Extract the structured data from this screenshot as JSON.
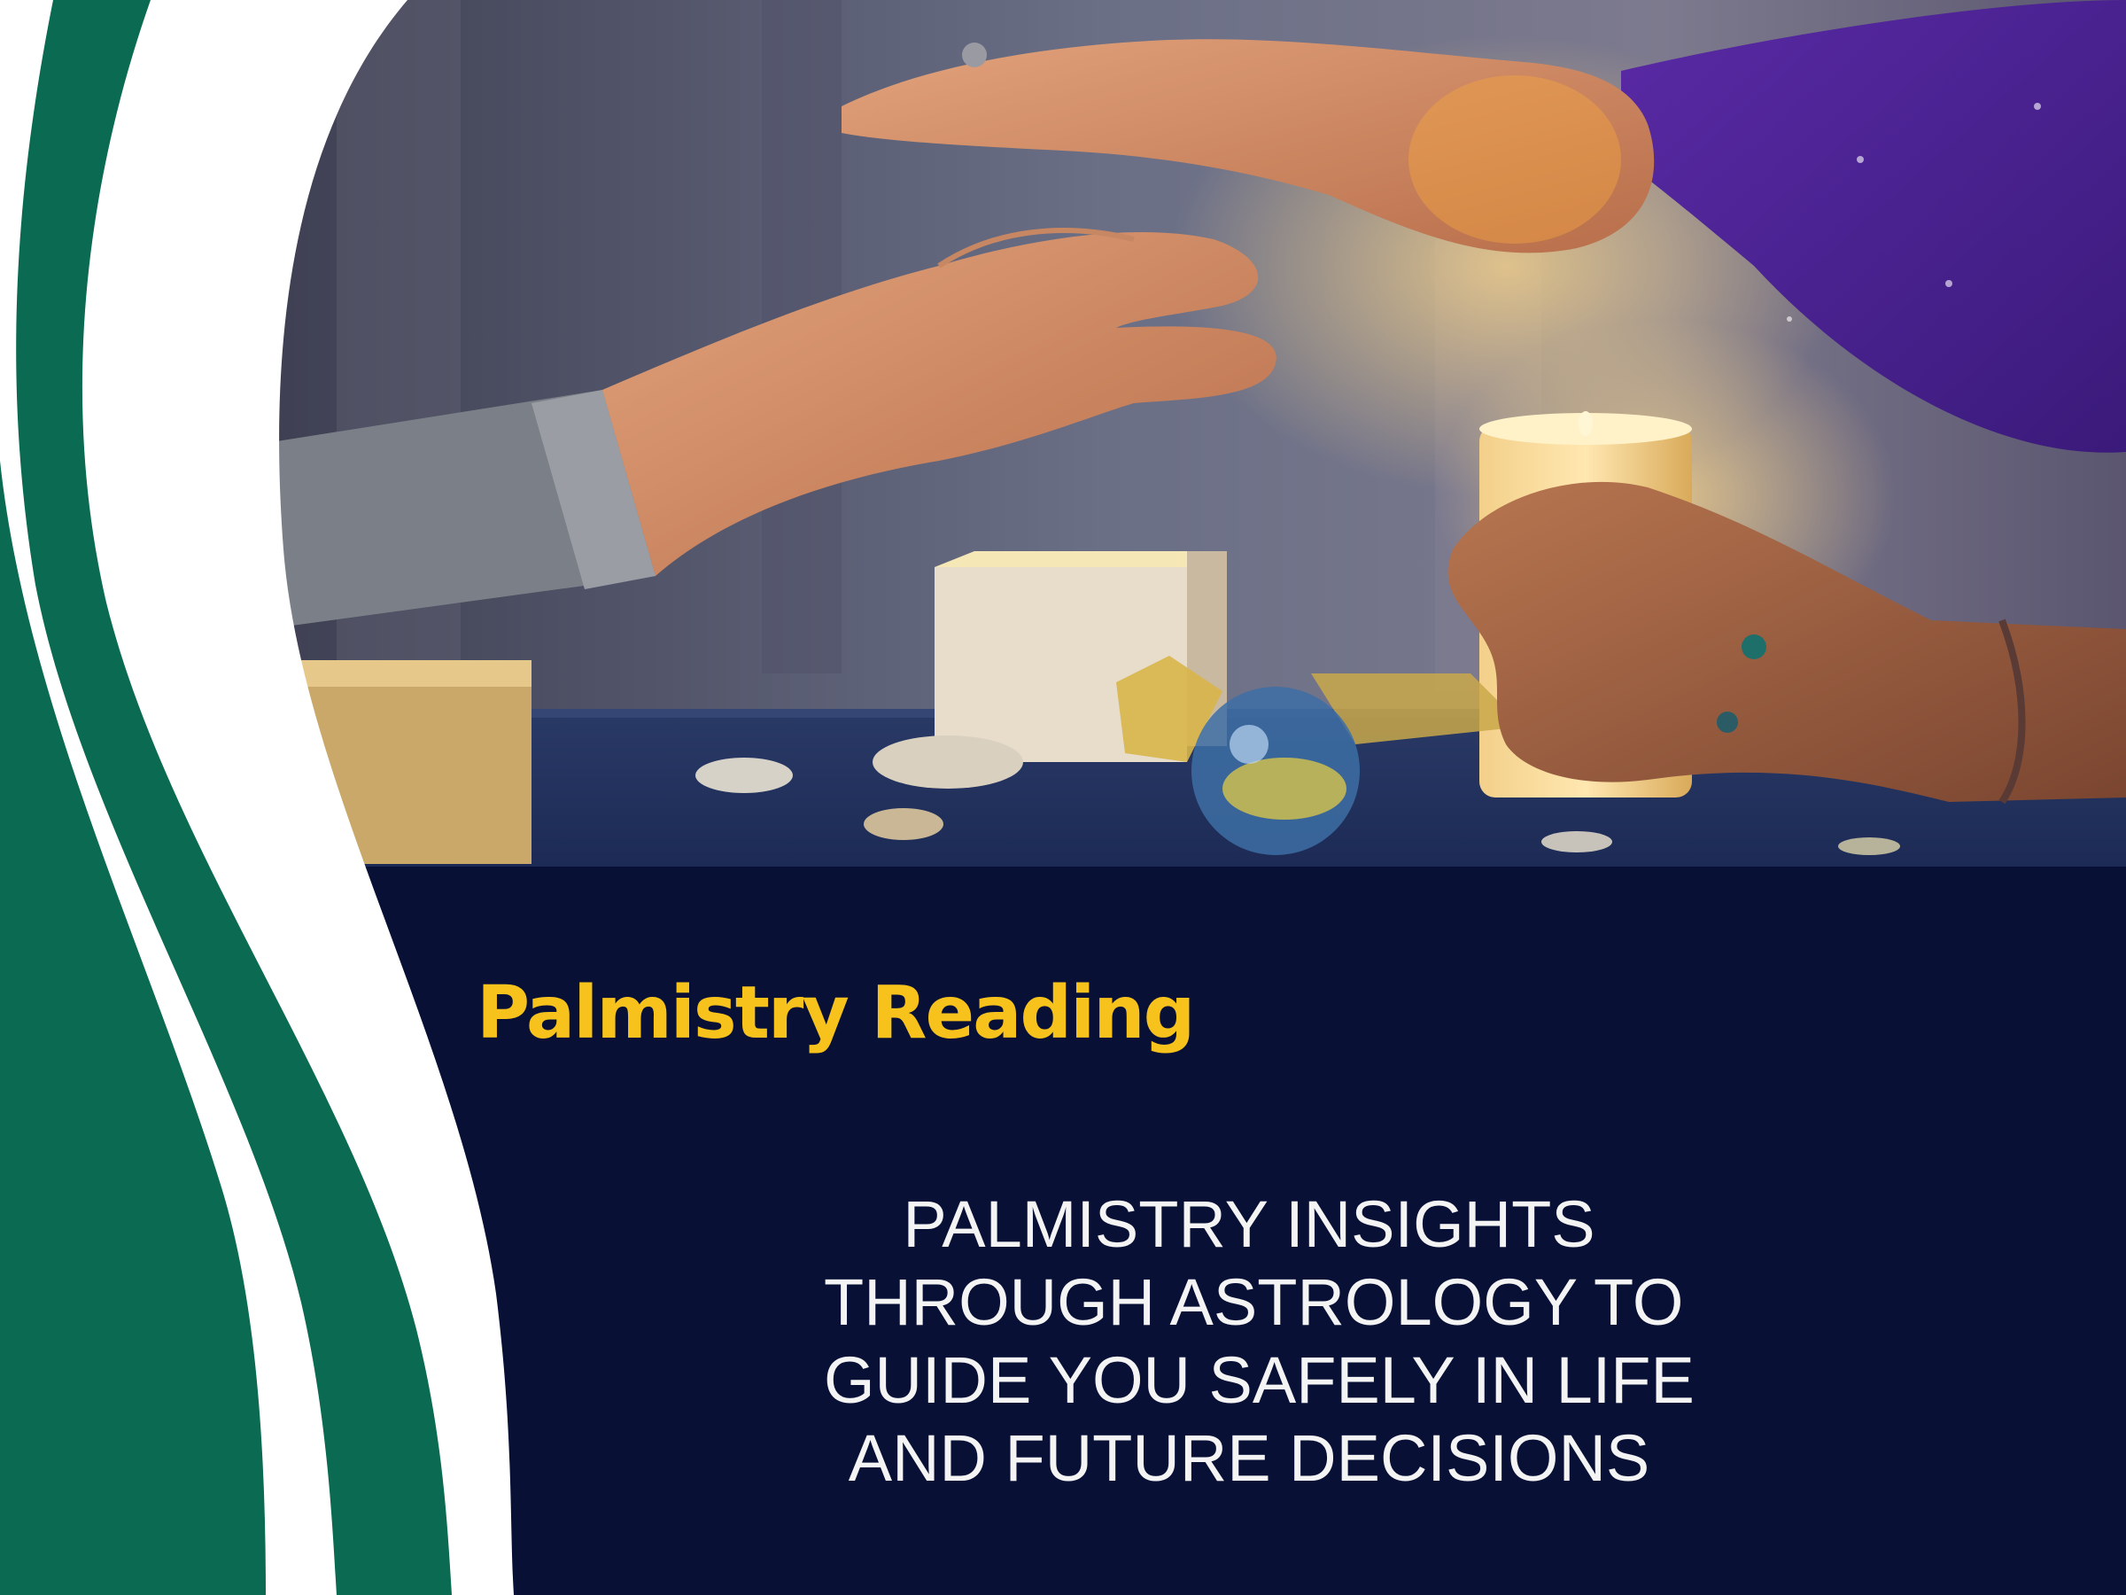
{
  "flyer": {
    "title": "Palmistry Reading",
    "tagline_lines": [
      "PALMISTRY INSIGHTS",
      "THROUGH ASTROLOGY TO",
      "GUIDE YOU SAFELY IN LIFE",
      "AND FUTURE DECISIONS"
    ]
  },
  "colors": {
    "navy_panel": "#081036",
    "title_yellow": "#f6c21b",
    "tagline_white": "#f4f4f4",
    "wave_green": "#0a6b52",
    "wave_white": "#ffffff"
  },
  "photo": {
    "subject": "hands-over-candles-palm-reading"
  }
}
